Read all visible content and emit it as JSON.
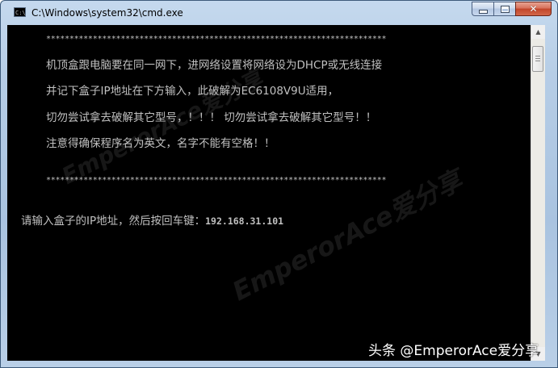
{
  "window": {
    "title": "C:\\Windows\\system32\\cmd.exe",
    "icon": "cmd-icon",
    "icon_text": "C:\\",
    "buttons": {
      "minimize_icon": "minimize-icon",
      "maximize_icon": "maximize-icon",
      "close_icon": "close-icon",
      "close_glyph": "✕"
    }
  },
  "console": {
    "separator": "*************************************************************************",
    "lines": [
      "机顶盒跟电脑要在同一网下，进网络设置将网络设为DHCP或无线连接",
      "并记下盒子IP地址在下方输入，此破解为EC6108V9U适用，",
      "切勿尝试拿去破解其它型号，！！！ 切勿尝试拿去破解其它型号！！",
      "注意得确保程序名为英文，名字不能有空格！！"
    ],
    "prompt_label": "请输入盒子的IP地址，然后按回车键：",
    "prompt_value": "192.168.31.101",
    "text_color": "#c0c0c0",
    "background_color": "#000000"
  },
  "scrollbar": {
    "up_arrow": "▲",
    "down_arrow": "▼"
  },
  "watermarks": {
    "text_1": "EmperorAce爱分享",
    "text_2": "EmperorAce爱分享"
  },
  "credit": "头条 @EmperorAce爱分享"
}
